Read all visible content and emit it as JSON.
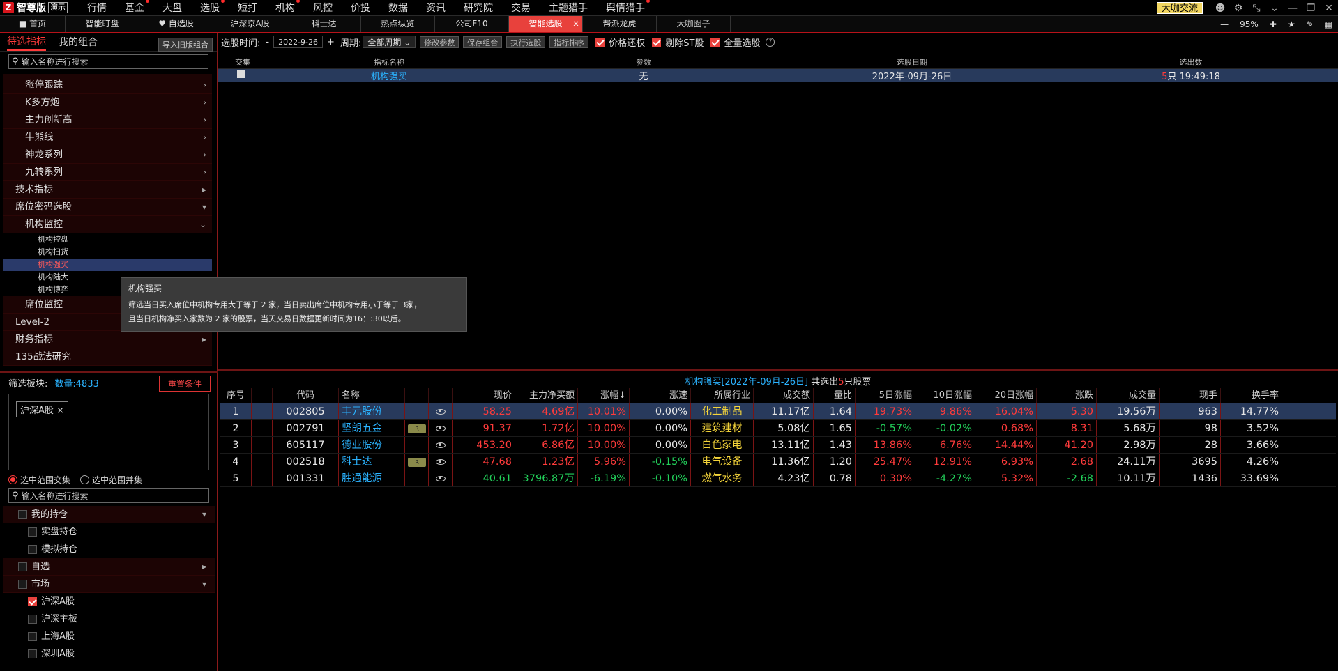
{
  "app": {
    "logo_mark": "Z",
    "logo_text": "智尊版",
    "logo_tag": "演示"
  },
  "menu": [
    {
      "label": "行情",
      "dot": false
    },
    {
      "label": "基金",
      "dot": true
    },
    {
      "label": "大盘",
      "dot": false
    },
    {
      "label": "选股",
      "dot": true
    },
    {
      "label": "短打",
      "dot": false
    },
    {
      "label": "机构",
      "dot": true
    },
    {
      "label": "风控",
      "dot": false
    },
    {
      "label": "价投",
      "dot": false
    },
    {
      "label": "数据",
      "dot": false
    },
    {
      "label": "资讯",
      "dot": false
    },
    {
      "label": "研究院",
      "dot": false
    },
    {
      "label": "交易",
      "dot": false
    },
    {
      "label": "主题猎手",
      "dot": false
    },
    {
      "label": "舆情猎手",
      "dot": true
    }
  ],
  "top_right": {
    "button": "大咖交流"
  },
  "tabs": [
    {
      "label": "首页",
      "icon": "home-icon"
    },
    {
      "label": "智能盯盘"
    },
    {
      "label": "自选股",
      "icon": "heart-icon"
    },
    {
      "label": "沪深京A股"
    },
    {
      "label": "科士达"
    },
    {
      "label": "热点纵览"
    },
    {
      "label": "公司F10"
    },
    {
      "label": "智能选股",
      "active": true
    },
    {
      "label": "帮派龙虎"
    },
    {
      "label": "大咖圈子"
    }
  ],
  "tab_tools": {
    "zoom": "95%"
  },
  "left": {
    "tab1": "待选指标",
    "tab2": "我的组合",
    "import_btn": "导入旧版组合",
    "search_placeholder": "输入名称进行搜索",
    "tree": [
      {
        "label": "涨停跟踪",
        "level": 2,
        "arrow": "›"
      },
      {
        "label": "K多方炮",
        "level": 2,
        "arrow": "›"
      },
      {
        "label": "主力创新高",
        "level": 2,
        "arrow": "›"
      },
      {
        "label": "牛熊线",
        "level": 2,
        "arrow": "›"
      },
      {
        "label": "神龙系列",
        "level": 2,
        "arrow": "›"
      },
      {
        "label": "九转系列",
        "level": 2,
        "arrow": "›"
      },
      {
        "label": "技术指标",
        "level": 1,
        "arrow": "▸"
      },
      {
        "label": "席位密码选股",
        "level": 1,
        "arrow": "▾"
      },
      {
        "label": "机构监控",
        "level": 2,
        "arrow": "⌄"
      }
    ],
    "subs": [
      "机构控盘",
      "机构扫货",
      "机构强买",
      "机构陆大",
      "机构博弈"
    ],
    "tree2": [
      {
        "label": "席位监控",
        "level": 2
      },
      {
        "label": "Level-2",
        "level": 1
      },
      {
        "label": "财务指标",
        "level": 1,
        "arrow": "▸"
      },
      {
        "label": "135战法研究",
        "level": 1
      }
    ],
    "filter_label": "筛选板块:",
    "count_label": "数量:4833",
    "reset_btn": "重置条件",
    "chip": "沪深A股",
    "radio1": "选中范围交集",
    "radio2": "选中范围并集",
    "search2_placeholder": "输入名称进行搜索",
    "filter_tree": [
      {
        "label": "我的持仓",
        "type": "grp",
        "arrow": "▾"
      },
      {
        "label": "实盘持仓",
        "type": "item"
      },
      {
        "label": "模拟持仓",
        "type": "item"
      },
      {
        "label": "自选",
        "type": "grp",
        "arrow": "▸"
      },
      {
        "label": "市场",
        "type": "grp",
        "arrow": "▾"
      },
      {
        "label": "沪深A股",
        "type": "item",
        "checked": true
      },
      {
        "label": "沪深主板",
        "type": "item"
      },
      {
        "label": "上海A股",
        "type": "item"
      },
      {
        "label": "深圳A股",
        "type": "item"
      }
    ]
  },
  "toolbar": {
    "date_label": "选股时间:",
    "minus": "-",
    "date": "2022-9-26",
    "plus": "+",
    "period_label": "周期:",
    "period": "全部周期",
    "btn_modify": "修改参数",
    "btn_save": "保存组合",
    "btn_run": "执行选股",
    "btn_sort": "指标排序",
    "chk1": "价格还权",
    "chk2": "剔除ST股",
    "chk3": "全量选股"
  },
  "strategy_table": {
    "headers": [
      "交集",
      "指标名称",
      "参数",
      "选股日期",
      "选出数"
    ],
    "row": {
      "name": "机构强买",
      "param": "无",
      "date": "2022年-09月-26日",
      "count": "5",
      "count_suffix": "只 19:49:18"
    }
  },
  "tooltip": {
    "title": "机构强买",
    "line1": "筛选当日买入席位中机构专用大于等于 2 家，当日卖出席位中机构专用小于等于 3家，",
    "line2": "且当日机构净买入家数为 2 家的股票，当天交易日数据更新时间为16：:30以后。"
  },
  "result": {
    "title_a": "机构强买[2022年-09月-26日]",
    "title_b": " 共选出",
    "count": "5",
    "title_c": "只股票",
    "headers": [
      "序号",
      "",
      "代码",
      "名称",
      "",
      "",
      "现价",
      "主力净买额",
      "涨幅↓",
      "涨速",
      "所属行业",
      "成交额",
      "量比",
      "5日涨幅",
      "10日涨幅",
      "20日涨幅",
      "涨跌",
      "成交量",
      "现手",
      "换手率"
    ],
    "rows": [
      [
        "1",
        "002805",
        "丰元股份",
        "",
        "58.25",
        "4.69亿",
        "10.01%",
        "0.00%",
        "化工制品",
        "11.17亿",
        "1.64",
        "19.73%",
        "9.86%",
        "16.04%",
        "5.30",
        "19.56万",
        "963",
        "14.77%"
      ],
      [
        "2",
        "002791",
        "坚朗五金",
        "R",
        "91.37",
        "1.72亿",
        "10.00%",
        "0.00%",
        "建筑建材",
        "5.08亿",
        "1.65",
        "-0.57%",
        "-0.02%",
        "0.68%",
        "8.31",
        "5.68万",
        "98",
        "3.52%"
      ],
      [
        "3",
        "605117",
        "德业股份",
        "",
        "453.20",
        "6.86亿",
        "10.00%",
        "0.00%",
        "白色家电",
        "13.11亿",
        "1.43",
        "13.86%",
        "6.76%",
        "14.44%",
        "41.20",
        "2.98万",
        "28",
        "3.66%"
      ],
      [
        "4",
        "002518",
        "科士达",
        "R",
        "47.68",
        "1.23亿",
        "5.96%",
        "-0.15%",
        "电气设备",
        "11.36亿",
        "1.20",
        "25.47%",
        "12.91%",
        "6.93%",
        "2.68",
        "24.11万",
        "3695",
        "4.26%"
      ],
      [
        "5",
        "001331",
        "胜通能源",
        "",
        "40.61",
        "3796.87万",
        "-6.19%",
        "-0.10%",
        "燃气水务",
        "4.23亿",
        "0.78",
        "0.30%",
        "-4.27%",
        "5.32%",
        "-2.68",
        "10.11万",
        "1436",
        "33.69%"
      ]
    ]
  },
  "colors": {
    "up": "#ff3b3b",
    "down": "#22d05a",
    "accent": "#e8413c",
    "name": "#2bb3ff",
    "industry": "#f5d53a"
  }
}
